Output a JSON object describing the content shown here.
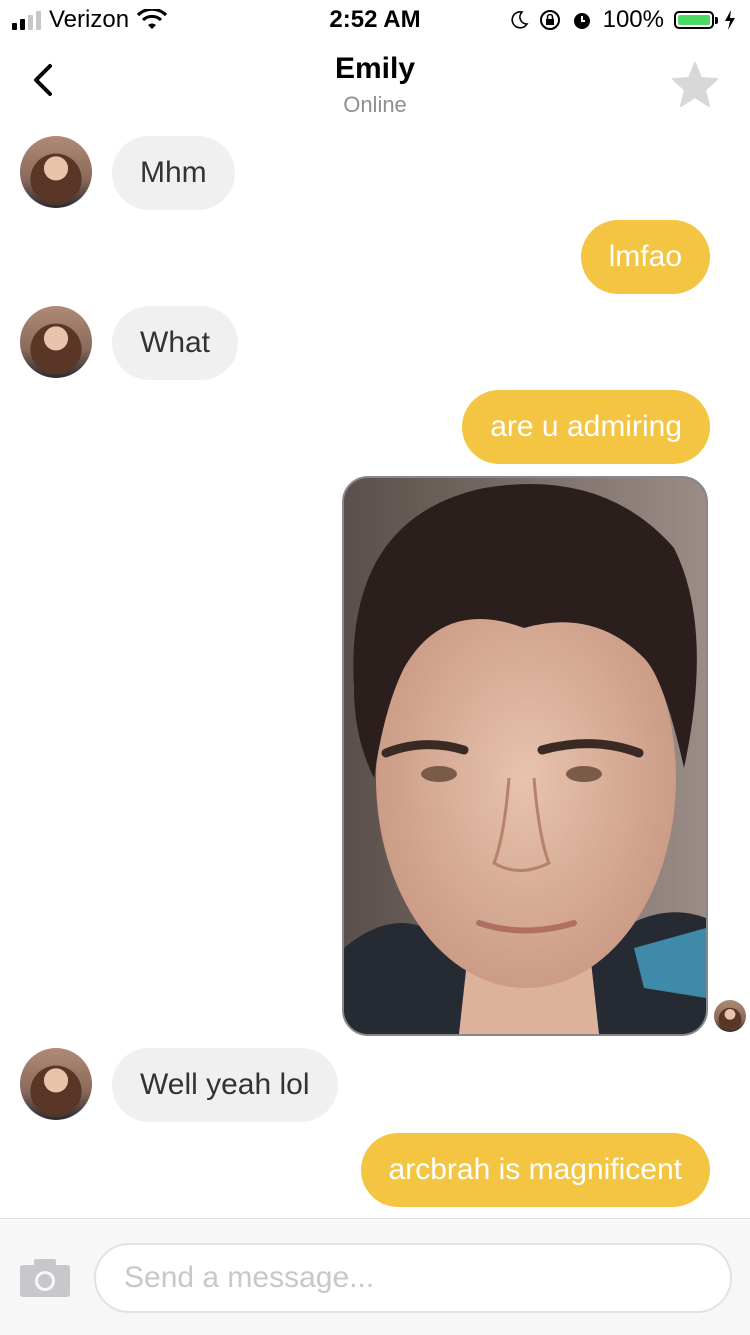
{
  "status_bar": {
    "carrier": "Verizon",
    "time": "2:52 AM",
    "battery_percent": "100%",
    "signal_bars_active": 2,
    "signal_bars_total": 4
  },
  "header": {
    "name": "Emily",
    "status": "Online"
  },
  "messages": [
    {
      "side": "in",
      "text": "Mhm"
    },
    {
      "side": "out",
      "text": "lmfao"
    },
    {
      "side": "in",
      "text": "What"
    },
    {
      "side": "out",
      "text": "are u admiring"
    },
    {
      "side": "out",
      "type": "photo"
    },
    {
      "side": "in",
      "text": "Well yeah lol"
    },
    {
      "side": "out",
      "text": "arcbrah is magnificent"
    }
  ],
  "composer": {
    "placeholder": "Send a message..."
  },
  "colors": {
    "outgoing_bubble": "#f4c542",
    "incoming_bubble": "#f0f0f0",
    "star": "#d8d8d8"
  }
}
